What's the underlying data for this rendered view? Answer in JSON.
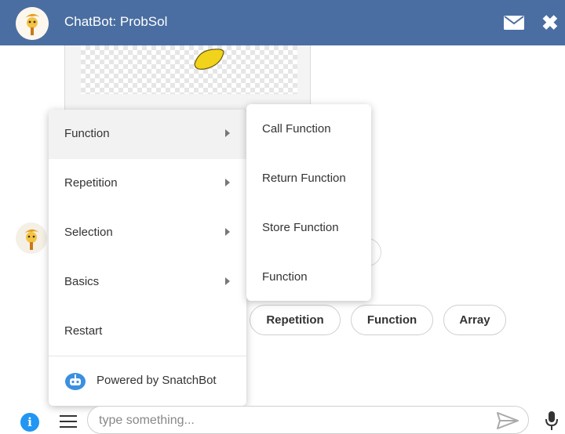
{
  "header": {
    "title": "ChatBot: ProbSol",
    "mail_icon": "envelope-icon",
    "close_icon": "close-icon",
    "background": "#4a6ea1"
  },
  "chat": {
    "image_icon": "lemon-image",
    "bot_avatar_icon": "bot-avatar-icon",
    "quick_replies": [
      "Repetition",
      "Function",
      "Array"
    ]
  },
  "menu": {
    "items": [
      {
        "label": "Function",
        "has_submenu": true,
        "active": true
      },
      {
        "label": "Repetition",
        "has_submenu": true
      },
      {
        "label": "Selection",
        "has_submenu": true
      },
      {
        "label": "Basics",
        "has_submenu": true
      },
      {
        "label": "Restart",
        "has_submenu": false
      }
    ],
    "footer": {
      "text": "Powered by SnatchBot",
      "icon": "snatchbot-logo-icon"
    }
  },
  "submenu": {
    "items": [
      "Call Function",
      "Return Function",
      "Store Function",
      "Function"
    ]
  },
  "input": {
    "placeholder": "type something...",
    "value": ""
  },
  "icons": {
    "info": "info-icon",
    "menu": "hamburger-icon",
    "send": "send-icon",
    "mic": "microphone-icon"
  },
  "colors": {
    "accent": "#2196f3",
    "header": "#4a6ea1"
  }
}
